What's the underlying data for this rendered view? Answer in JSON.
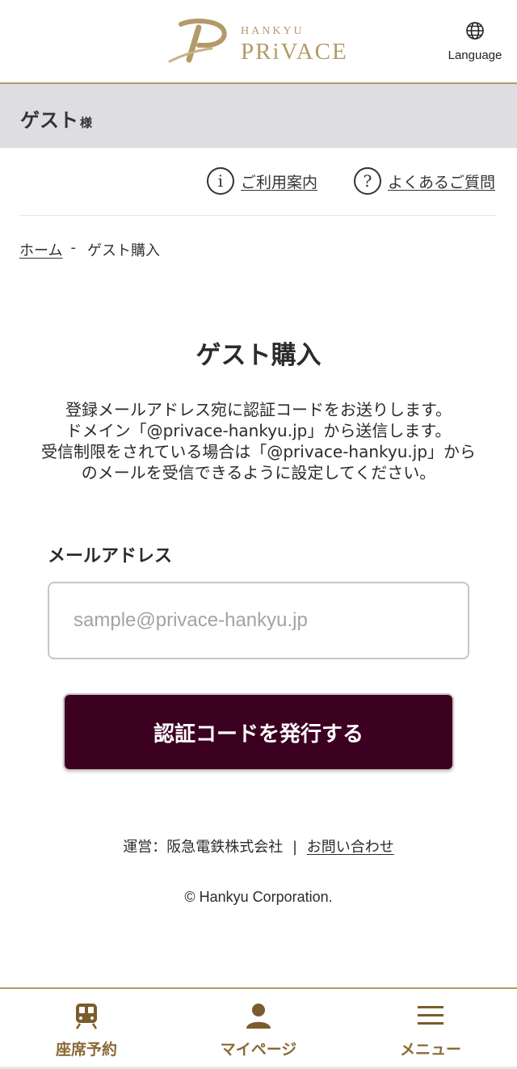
{
  "header": {
    "logo_sub": "HANKYU",
    "logo_main": "PRiVACE",
    "language_label": "Language"
  },
  "guest_bar": {
    "name": "ゲスト",
    "honorific": "様"
  },
  "help_links": {
    "guide_label": "ご利用案内",
    "faq_label": "よくあるご質問"
  },
  "breadcrumb": {
    "home": "ホーム",
    "separator": "-",
    "current": "ゲスト購入"
  },
  "main": {
    "title": "ゲスト購入",
    "description_lines": [
      "登録メールアドレス宛に認証コードをお送りします。",
      "ドメイン「@privace-hankyu.jp」から送信します。",
      "受信制限をされている場合は「@privace-hankyu.jp」から",
      "のメールを受信できるように設定してください。"
    ],
    "email_label": "メールアドレス",
    "email_placeholder": "sample@privace-hankyu.jp",
    "email_value": "",
    "submit_label": "認証コードを発行する"
  },
  "footer": {
    "operator_text": "運営：阪急電鉄株式会社",
    "divider": "|",
    "contact_label": "お問い合わせ",
    "copyright": "© Hankyu Corporation."
  },
  "bottom_nav": {
    "items": [
      {
        "label": "座席予約",
        "icon": "train-icon"
      },
      {
        "label": "マイページ",
        "icon": "person-icon"
      },
      {
        "label": "メニュー",
        "icon": "hamburger-menu-icon"
      }
    ]
  },
  "colors": {
    "gold": "#b49a6a",
    "nav_label": "#8a6a35",
    "button_bg": "#3c0020",
    "guest_bar_bg": "#dedee2"
  }
}
